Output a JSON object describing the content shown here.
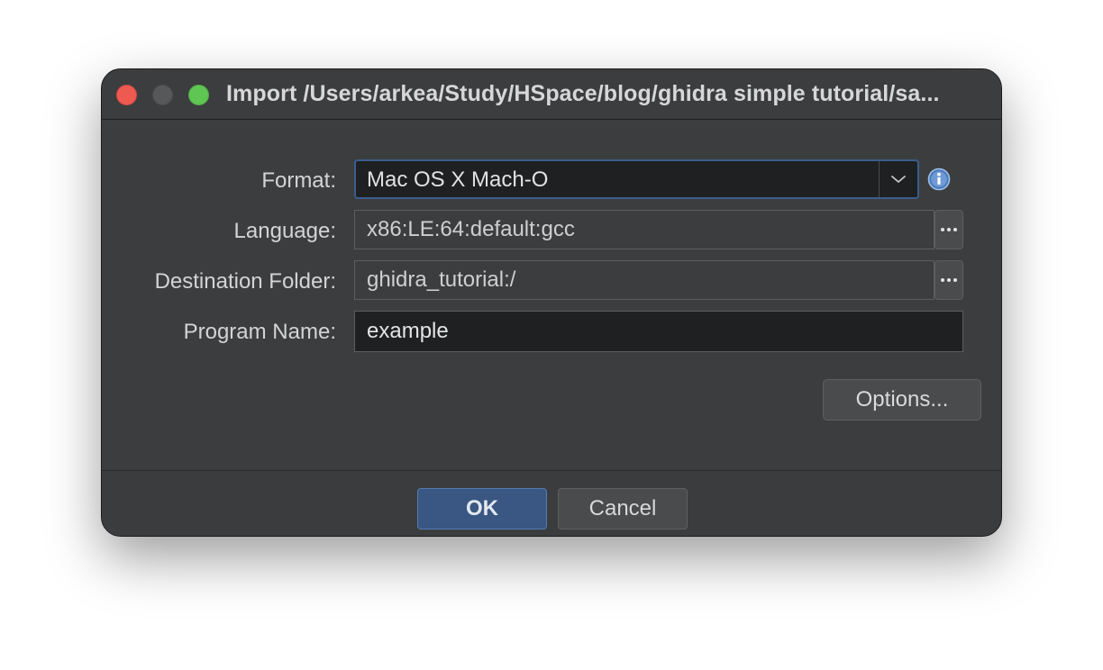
{
  "window": {
    "title": "Import /Users/arkea/Study/HSpace/blog/ghidra simple tutorial/sa..."
  },
  "form": {
    "format_label": "Format:",
    "format_value": "Mac OS X Mach-O",
    "language_label": "Language:",
    "language_value": "x86:LE:64:default:gcc",
    "destination_label": "Destination Folder:",
    "destination_value": "ghidra_tutorial:/",
    "program_name_label": "Program Name:",
    "program_name_value": "example",
    "options_label": "Options..."
  },
  "footer": {
    "ok_label": "OK",
    "cancel_label": "Cancel"
  },
  "colors": {
    "window_bg": "#3c3d3f",
    "ok_button": "#395782",
    "focus_border": "#3a5e8c",
    "close": "#ee5a52",
    "maximize": "#5fc553"
  },
  "icons": [
    "close-icon",
    "minimize-icon",
    "maximize-icon",
    "chevron-down-icon",
    "info-icon",
    "ellipsis-icon"
  ]
}
